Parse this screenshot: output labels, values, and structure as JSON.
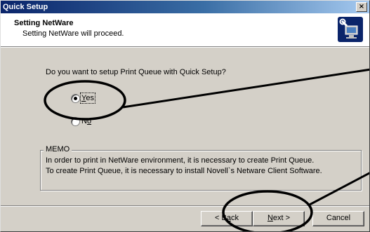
{
  "window": {
    "title": "Quick Setup",
    "close_glyph": "×"
  },
  "header": {
    "title": "Setting NetWare",
    "subtitle": "Setting NetWare will proceed.",
    "icon": "computer-wrench-icon"
  },
  "question": "Do you want to setup Print Queue with Quick Setup?",
  "options": [
    {
      "label_mnemonic": "Y",
      "label_rest": "es",
      "selected": true
    },
    {
      "label_prefix": "N",
      "label_mnemonic": "o",
      "selected": false
    }
  ],
  "memo": {
    "legend": "MEMO",
    "lines": [
      "In order to print in NetWare environment, it is necessary to create Print Queue.",
      "To create Print Queue, it is necessary to install Novell`s Netware Client Software."
    ]
  },
  "buttons": {
    "back_prefix": "< B",
    "back_mnemonic": "a",
    "back_rest": "ck",
    "next_mnemonic": "N",
    "next_rest": "ext >",
    "cancel": "Cancel"
  },
  "colors": {
    "titlebar_start": "#0a246a",
    "titlebar_end": "#a6caf0",
    "dialog_face": "#d4d0c8",
    "callout_stroke": "#000000"
  }
}
